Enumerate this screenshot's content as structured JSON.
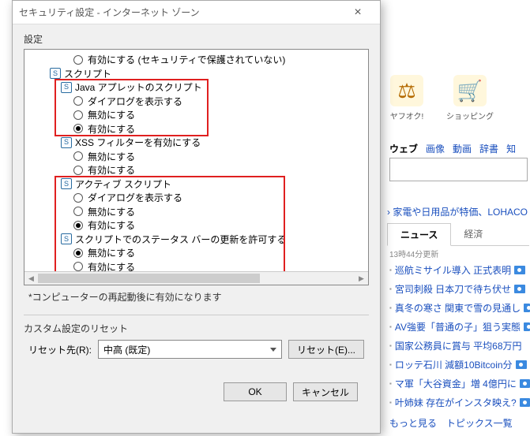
{
  "dialog": {
    "title": "セキュリティ設定 - インターネット ゾーン",
    "settings_label": "設定",
    "settings": {
      "orphan_radio": {
        "label": "有効にする (セキュリティで保護されていない)",
        "selected": false
      },
      "script_group": "スクリプト",
      "java_applets": {
        "label": "Java アプレットのスクリプト",
        "options": [
          {
            "label": "ダイアログを表示する",
            "selected": false
          },
          {
            "label": "無効にする",
            "selected": false
          },
          {
            "label": "有効にする",
            "selected": true
          }
        ]
      },
      "xss_filter": {
        "label": "XSS フィルターを有効にする",
        "options": [
          {
            "label": "無効にする",
            "selected": false
          },
          {
            "label": "有効にする",
            "selected": false
          }
        ]
      },
      "active_script": {
        "label": "アクティブ スクリプト",
        "options": [
          {
            "label": "ダイアログを表示する",
            "selected": false
          },
          {
            "label": "無効にする",
            "selected": false
          },
          {
            "label": "有効にする",
            "selected": true
          }
        ]
      },
      "status_bar": {
        "label": "スクリプトでのステータス バーの更新を許可する",
        "options": [
          {
            "label": "無効にする",
            "selected": true
          },
          {
            "label": "有効にする",
            "selected": false
          }
        ]
      }
    },
    "note": "*コンピューターの再起動後に有効になります",
    "reset_section": "カスタム設定のリセット",
    "reset_label": "リセット先(R):",
    "reset_value": "中高 (既定)",
    "reset_button": "リセット(E)...",
    "ok": "OK",
    "cancel": "キャンセル"
  },
  "portal": {
    "icons": {
      "auction": "ヤフオク!",
      "shopping": "ショッピング"
    },
    "search_tabs": [
      "ウェブ",
      "画像",
      "動画",
      "辞書",
      "知"
    ],
    "promo": "› 家電や日用品が特価、LOHACO",
    "news_tabs": [
      "ニュース",
      "経済"
    ],
    "timestamp": "13時44分更新",
    "news": [
      "巡航ミサイル導入 正式表明",
      "宮司刺殺 日本刀で待ち伏せ",
      "真冬の寒さ 関東で雪の見通し",
      "AV強要「普通の子」狙う実態",
      "国家公務員に賞与 平均68万円",
      "ロッテ石川 減額10Bitcoin分",
      "マ軍「大谷資金」増 4億円に",
      "叶姉妹 存在がインスタ映え?"
    ],
    "more": "もっと見る　トピックス一覧"
  }
}
